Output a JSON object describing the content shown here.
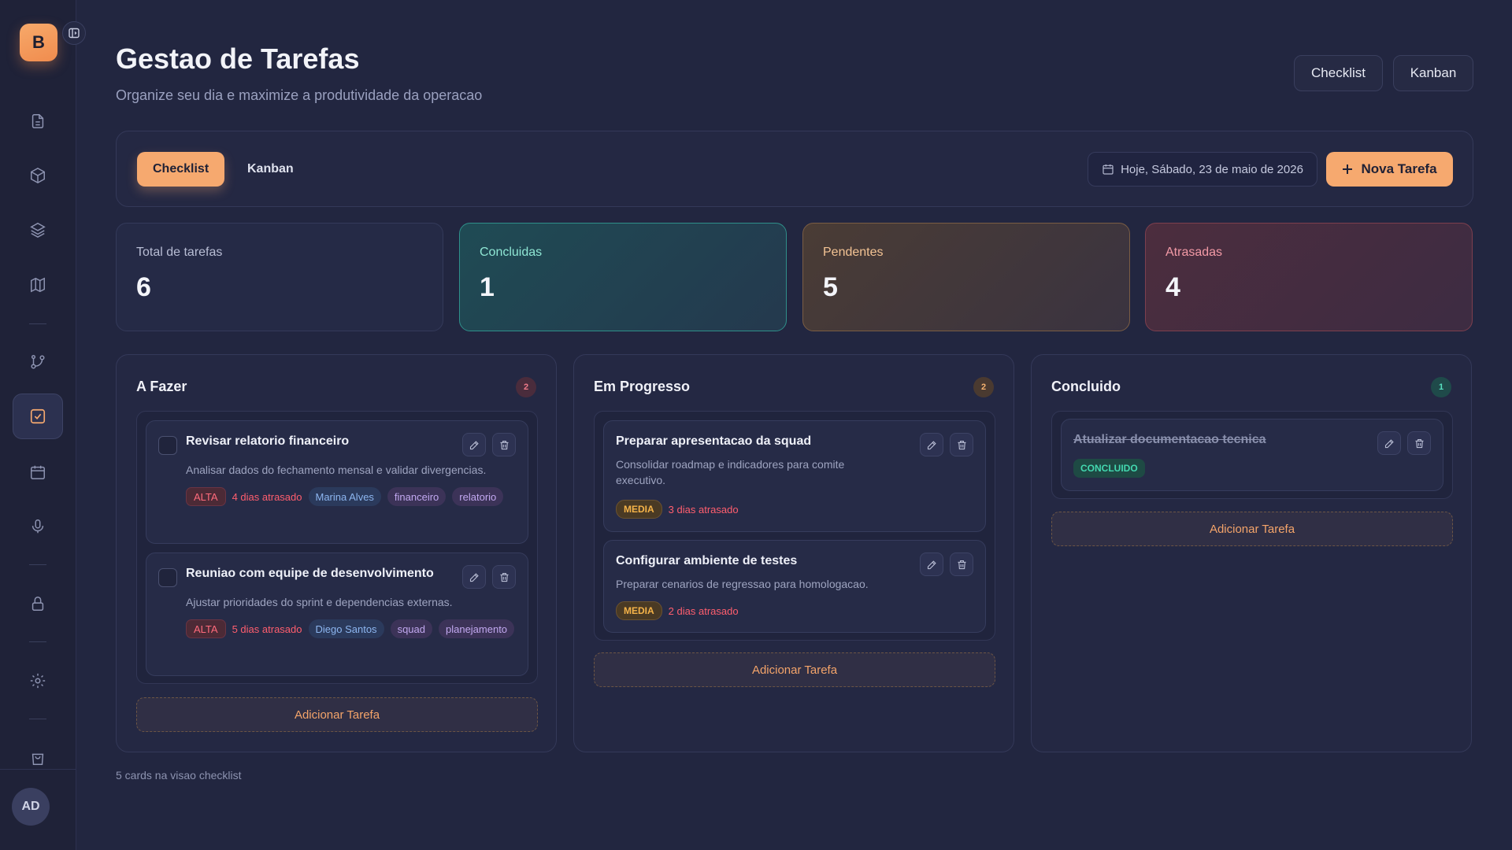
{
  "app": {
    "logo_letter": "B",
    "user_initials": "AD"
  },
  "sidebar": {
    "items": [
      {
        "icon": "file-icon"
      },
      {
        "icon": "box-icon"
      },
      {
        "icon": "layers-icon"
      },
      {
        "icon": "map-icon"
      },
      {
        "icon": "git-branch-icon"
      },
      {
        "icon": "check-square-icon",
        "active": true
      },
      {
        "icon": "calendar-icon"
      },
      {
        "icon": "microphone-icon"
      },
      {
        "icon": "lock-icon"
      },
      {
        "icon": "gear-icon"
      },
      {
        "icon": "shopping-bag-icon"
      }
    ]
  },
  "header": {
    "title": "Gestao de Tarefas",
    "subtitle": "Organize seu dia e maximize a produtividade da operacao",
    "view_buttons": [
      "Checklist",
      "Kanban"
    ]
  },
  "toolbar": {
    "tabs": [
      {
        "label": "Checklist",
        "active": true
      },
      {
        "label": "Kanban",
        "active": false
      }
    ],
    "date_label": "Hoje, Sábado, 23 de maio de 2026",
    "new_task_label": "Nova Tarefa"
  },
  "stats": [
    {
      "label": "Total de tarefas",
      "value": "6"
    },
    {
      "label": "Concluidas",
      "value": "1"
    },
    {
      "label": "Pendentes",
      "value": "5"
    },
    {
      "label": "Atrasadas",
      "value": "4"
    }
  ],
  "columns": [
    {
      "title": "A Fazer",
      "count": "2",
      "add_label": "Adicionar Tarefa",
      "cards": [
        {
          "title": "Revisar relatorio financeiro",
          "description": "Analisar dados do fechamento mensal e validar divergencias.",
          "priority": "ALTA",
          "overdue": "4 dias atrasado",
          "assignee": "Marina Alves",
          "tags": [
            "financeiro",
            "relatorio"
          ]
        },
        {
          "title": "Reuniao com equipe de desenvolvimento",
          "description": "Ajustar prioridades do sprint e dependencias externas.",
          "priority": "ALTA",
          "overdue": "5 dias atrasado",
          "assignee": "Diego Santos",
          "tags": [
            "squad",
            "planejamento"
          ]
        }
      ]
    },
    {
      "title": "Em Progresso",
      "count": "2",
      "add_label": "Adicionar Tarefa",
      "cards": [
        {
          "title": "Preparar apresentacao da squad",
          "description_lines": [
            "Consolidar roadmap e indicadores para comite",
            "executivo."
          ],
          "priority": "MEDIA",
          "overdue": "3 dias atrasado"
        },
        {
          "title": "Configurar ambiente de testes",
          "description": "Preparar cenarios de regressao para homologacao.",
          "priority": "MEDIA",
          "overdue": "2 dias atrasado"
        }
      ]
    },
    {
      "title": "Concluido",
      "count": "1",
      "add_label": "Adicionar Tarefa",
      "cards": [
        {
          "title": "Atualizar documentacao tecnica",
          "status": "CONCLUIDO"
        }
      ]
    }
  ],
  "footer_note": "5 cards na visao checklist",
  "colors": {
    "accent": "#f6a96f",
    "danger": "#ff5e6e",
    "success": "#43d8b0",
    "warning": "#f5b349"
  }
}
